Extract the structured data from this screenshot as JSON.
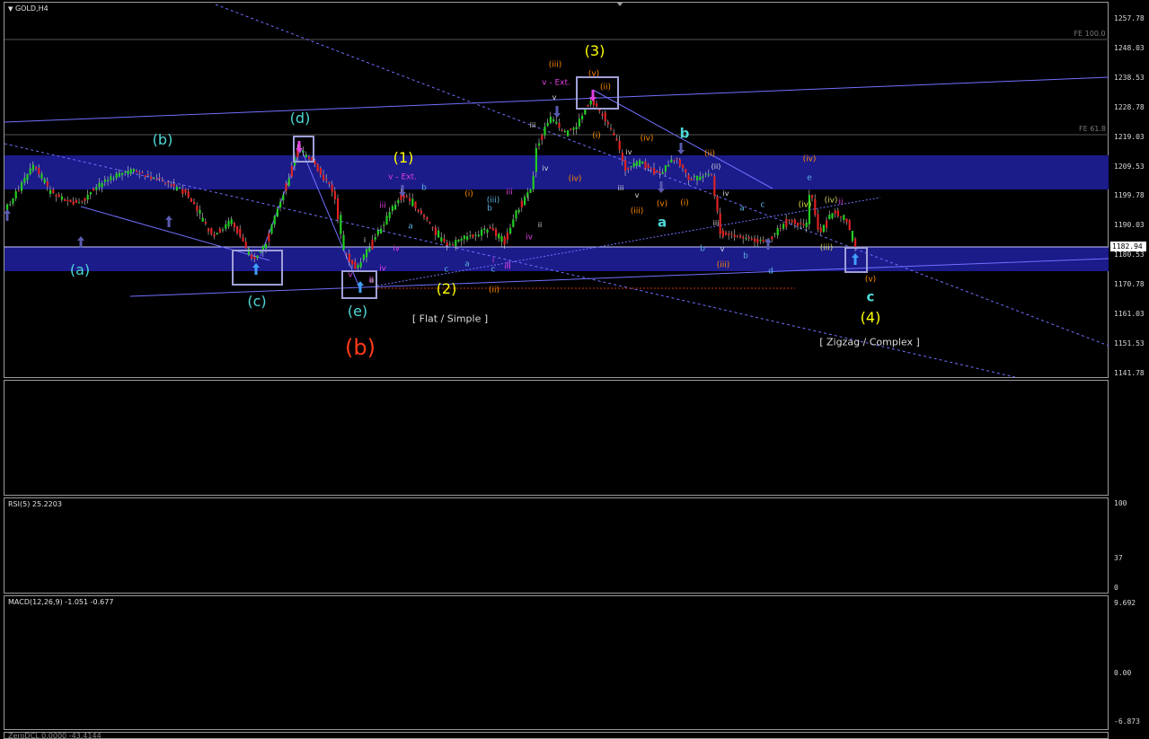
{
  "window": {
    "symbol_title": "GOLD,H4",
    "menu_icon": "triangle-down-icon",
    "scroll_icon": "triangle-down-icon"
  },
  "price_axis": {
    "ticks": [
      "1257.78",
      "1248.03",
      "1238.53",
      "1228.78",
      "1219.03",
      "1209.53",
      "1199.78",
      "1190.03",
      "1180.53",
      "1170.78",
      "1161.03",
      "1151.53",
      "1141.78"
    ],
    "current_price": "1182.94"
  },
  "fib_labels": {
    "fe100": "FE 100.0",
    "fe618": "FE 61.8"
  },
  "colors": {
    "background": "#000000",
    "zone": "#1b1b8a",
    "bull_candle": "#22cc22",
    "bear_candle": "#dd2222",
    "trendline": "#7070ff",
    "wave_yellow": "#ffff00",
    "wave_cyan": "#4fd8d8",
    "wave_orange": "#ff8a00",
    "wave_red": "#ff3a1a",
    "wave_magenta": "#e040e0"
  },
  "wave_labels": {
    "a_low": "(a)",
    "b_high": "(b)",
    "c_low": "(c)",
    "d_high": "(d)",
    "e_low": "(e)",
    "big_b": "(b)",
    "w1": "(1)",
    "w2": "(2)",
    "w3": "(3)",
    "w4": "(4)",
    "v_ext_1": "v - Ext.",
    "v_ext_3": "v - Ext.",
    "flat_simple": "[ Flat / Simple ]",
    "zigzag_complex": "[ Zigzag / Complex ]",
    "a_cyan": "a",
    "b_cyan": "b",
    "c_cyan": "c",
    "iii_o": "(iii)",
    "v_o": "(v)",
    "ii_o": "(ii)",
    "i_o": "(i)",
    "iv_o": "(iv)",
    "iv_o2": "(iv)",
    "iii_o2": "(iii)",
    "v_o2": "(v)",
    "ii_o2": "(ii)",
    "i_o2": "(i)",
    "iv_o3": "(iv)",
    "iii_o3": "(iii)",
    "iv_o4": "(iv)",
    "ii_o3": "(ii)",
    "i_o3": "(i)",
    "v_o3": "(v)",
    "iii_o4": "(iii)",
    "m_iii": "iii",
    "m_iv": "iv",
    "m_v": "v",
    "m_ii": "ii",
    "m_iii2": "iii",
    "m_i": "i",
    "m_iv2": "iv",
    "m_iii3": "iii",
    "m_iv3": "iv",
    "m_ii2": "ii",
    "m_ii3": "ii",
    "w_i": "i",
    "w_ii": "ii",
    "w_iii": "iii",
    "w_iv": "iv",
    "w_v": "v",
    "w_i2": "i",
    "w_ii2": "ii",
    "w_iii2": "iii",
    "w_iv2": "iv",
    "w_v2": "v",
    "w_iii3": "iii",
    "w_iv3": "iv",
    "w_v3": "v",
    "s_a": "a",
    "s_b": "b",
    "s_c": "c",
    "s_a2": "a",
    "s_b2": "b",
    "s_c2": "c",
    "s_a3": "a",
    "s_b3": "b",
    "s_c3": "c",
    "s_d": "d",
    "s_e": "e",
    "s_b4": "b",
    "iii_ww": "(iii)",
    "iv_ww": "(iv)",
    "ii_ww": "(ii)"
  },
  "indicator1": {
    "title": ""
  },
  "rsi": {
    "title": "RSI(5) 25.2203",
    "ticks": [
      "100",
      "37",
      "0"
    ]
  },
  "macd": {
    "title": "MACD(12,26,9) -1.051 -0.677",
    "ticks": [
      "9.692",
      "0.00",
      "-6.873"
    ]
  },
  "bottom_strip": {
    "title": "ZeroDCL 0.0000 -43.4144"
  }
}
